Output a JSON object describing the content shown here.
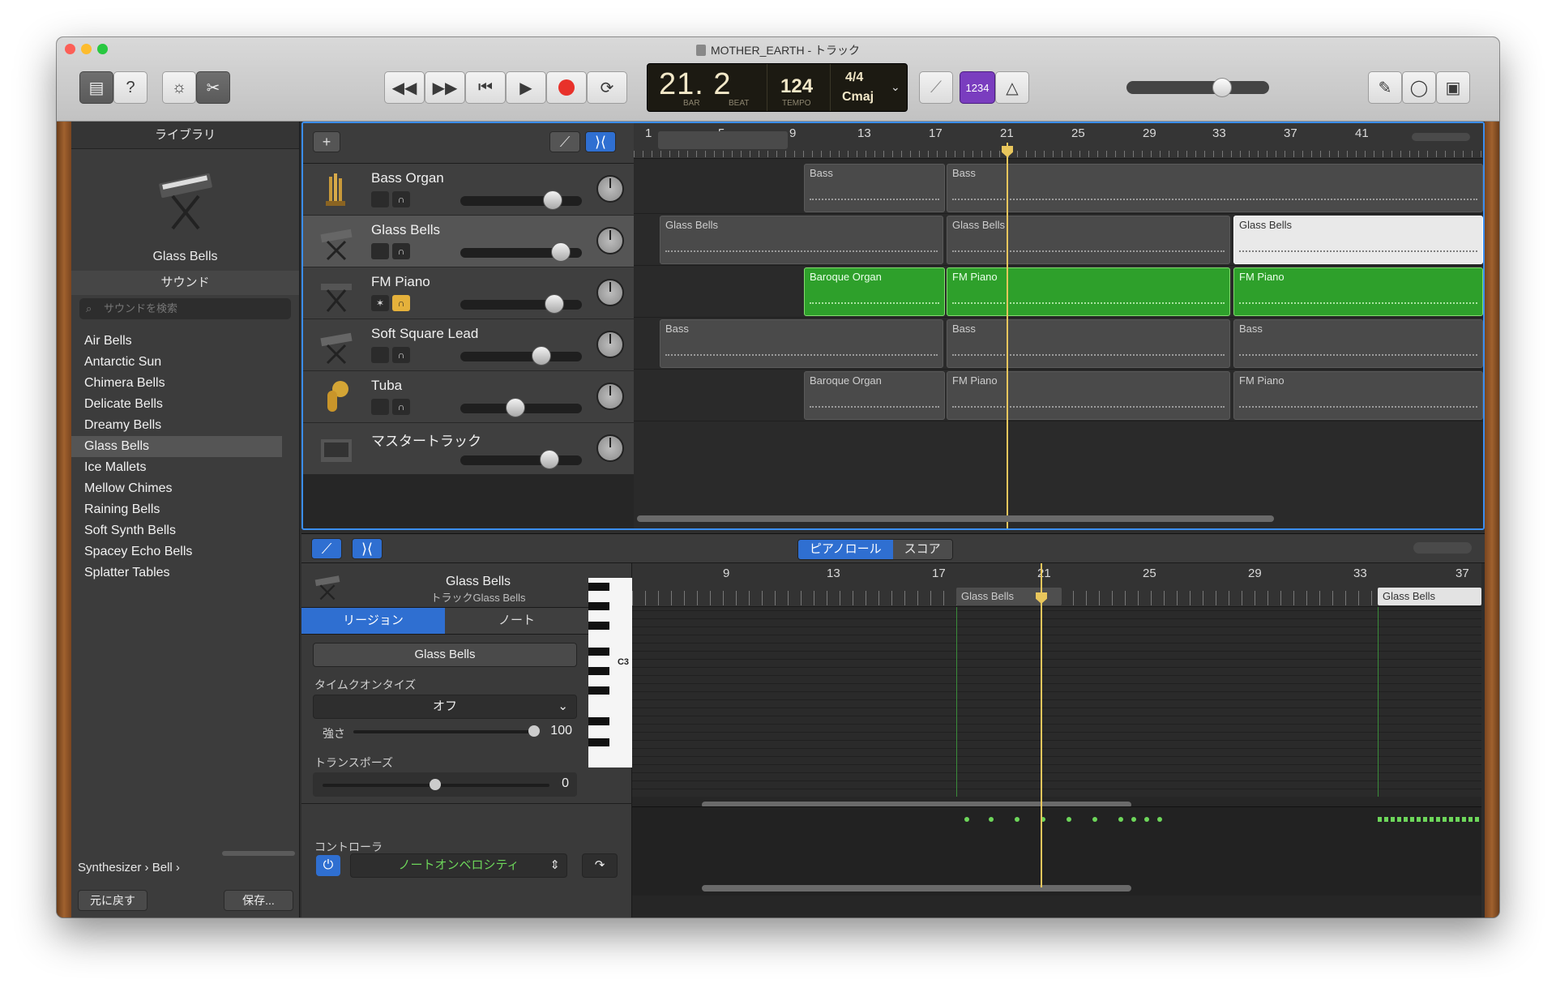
{
  "window": {
    "title": "MOTHER_EARTH - トラック"
  },
  "lcd": {
    "bar_beat": "21. 2",
    "bar_label": "BAR",
    "beat_label": "BEAT",
    "tempo": "124",
    "tempo_label": "TEMPO",
    "time_sig": "4/4",
    "key": "Cmaj"
  },
  "toolbar": {
    "count_in_label": "1234"
  },
  "library": {
    "header": "ライブラリ",
    "selected_patch": "Glass Bells",
    "sound_header": "サウンド",
    "search_placeholder": "サウンドを検索",
    "items": [
      "Air Bells",
      "Antarctic Sun",
      "Chimera Bells",
      "Delicate Bells",
      "Dreamy Bells",
      "Glass Bells",
      "Ice Mallets",
      "Mellow Chimes",
      "Raining Bells",
      "Soft Synth Bells",
      "Spacey Echo Bells",
      "Splatter Tables"
    ],
    "selected_index": 5,
    "path": [
      "Synthesizer",
      "Bell"
    ],
    "revert_label": "元に戻す",
    "save_label": "保存..."
  },
  "tracks": [
    {
      "name": "Bass Organ",
      "volume": 0.68,
      "selected": false
    },
    {
      "name": "Glass Bells",
      "volume": 0.75,
      "selected": true
    },
    {
      "name": "FM Piano",
      "volume": 0.7,
      "selected": false
    },
    {
      "name": "Soft Square Lead",
      "volume": 0.6,
      "selected": false
    },
    {
      "name": "Tuba",
      "volume": 0.4,
      "selected": false
    },
    {
      "name": "マスタートラック",
      "volume": 0.65,
      "selected": false
    }
  ],
  "ruler": {
    "bars": [
      "1",
      "5",
      "9",
      "13",
      "17",
      "21",
      "25",
      "29",
      "33",
      "37",
      "41"
    ]
  },
  "regions": {
    "bass_a": "Bass",
    "bass_b": "Bass",
    "gb_a": "Glass Bells",
    "gb_b": "Glass Bells",
    "gb_c": "Glass Bells",
    "fm_a": "Baroque Organ",
    "fm_b": "FM Piano",
    "fm_c": "FM Piano",
    "ssl_a": "Bass",
    "ssl_b": "Bass",
    "ssl_c": "Bass",
    "tuba_a": "Baroque Organ",
    "tuba_b": "FM Piano",
    "tuba_c": "FM Piano"
  },
  "editor": {
    "tabs": [
      "ピアノロール",
      "スコア"
    ],
    "track_name": "Glass Bells",
    "track_sub": "トラックGlass Bells",
    "inspector_tabs": [
      "リージョン",
      "ノート"
    ],
    "region_name": "Glass Bells",
    "quantize_label": "タイムクオンタイズ",
    "quantize_value": "オフ",
    "strength_label": "強さ",
    "strength_value": "100",
    "transpose_label": "トランスポーズ",
    "transpose_value": "0",
    "controller_label": "コントローラ",
    "controller_value": "ノートオンベロシティ",
    "ruler": [
      "9",
      "13",
      "17",
      "21",
      "25",
      "29",
      "33",
      "37"
    ],
    "region_a": "Glass Bells",
    "region_b": "Glass Bells",
    "c3_label": "C3"
  },
  "colors": {
    "accent": "#2f6fd1",
    "green_region": "#2ea02b",
    "playhead": "#e8c65c",
    "record": "#e8312a"
  }
}
